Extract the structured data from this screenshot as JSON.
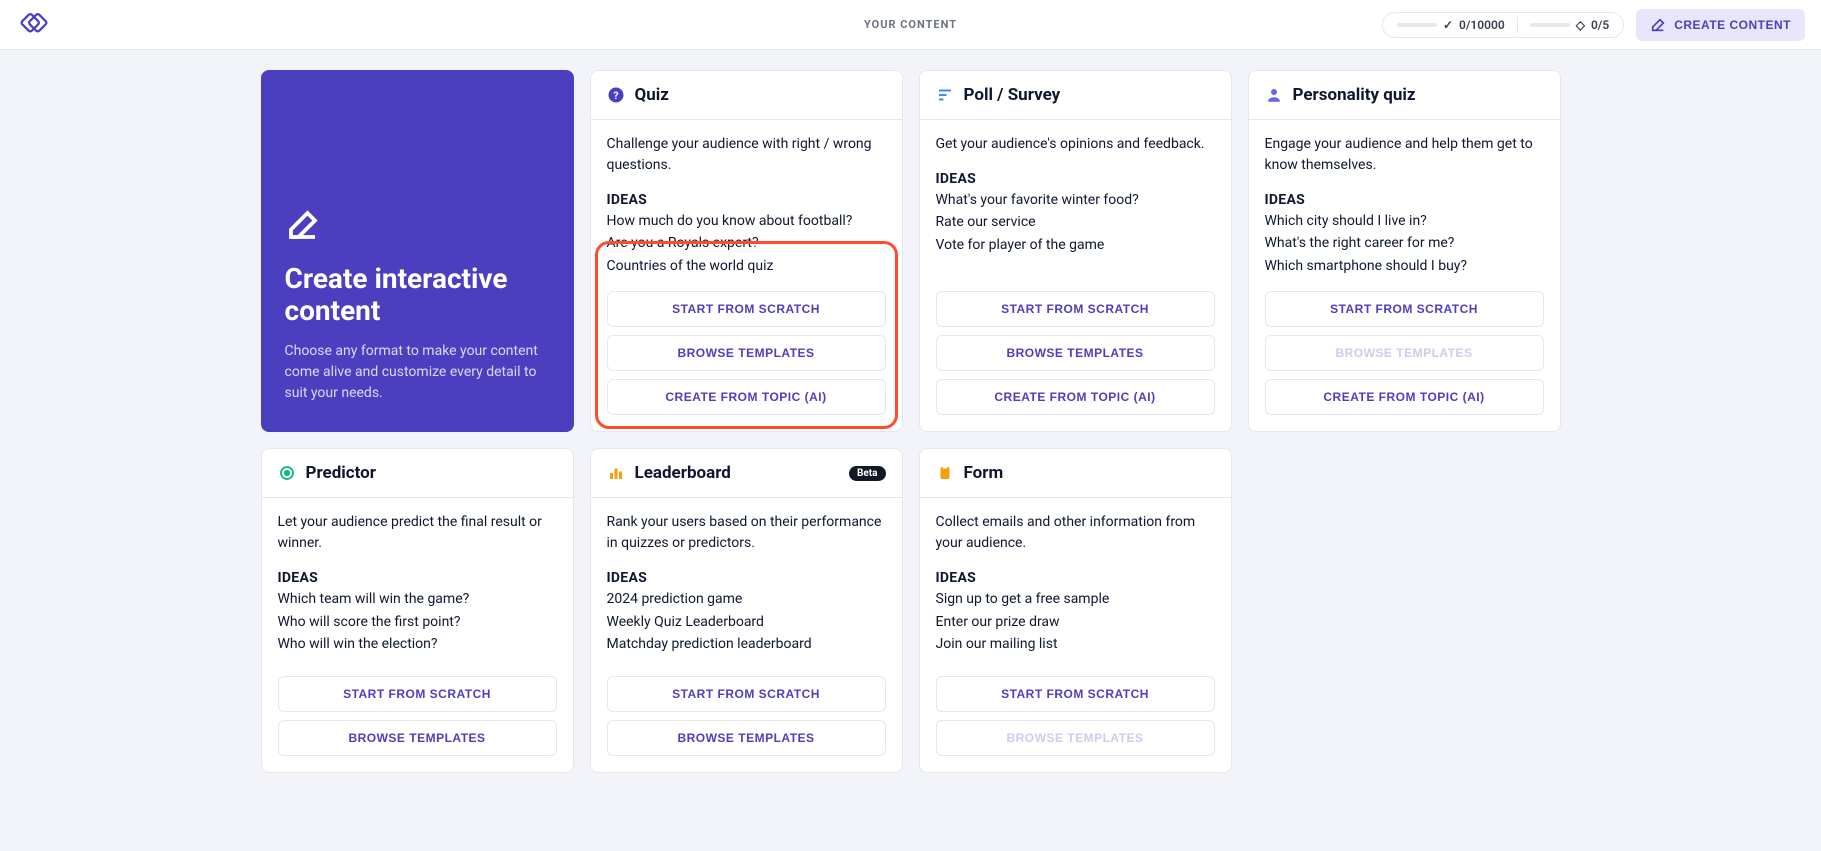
{
  "header": {
    "pageTitle": "YOUR CONTENT",
    "quota": {
      "credits": "0/10000",
      "slots": "0/5"
    },
    "createButton": "CREATE CONTENT"
  },
  "hero": {
    "title": "Create interactive content",
    "subtitle": "Choose any format to make your content come alive and customize every detail to suit your needs."
  },
  "ideasLabel": "IDEAS",
  "buttons": {
    "scratch": "START FROM SCRATCH",
    "templates": "BROWSE TEMPLATES",
    "ai": "CREATE FROM TOPIC (AI)"
  },
  "cards": {
    "quiz": {
      "title": "Quiz",
      "desc": "Challenge your audience with right / wrong questions.",
      "ideas": [
        "How much do you know about football?",
        "Are you a Royals expert?",
        "Countries of the world quiz"
      ]
    },
    "poll": {
      "title": "Poll / Survey",
      "desc": "Get your audience's opinions and feedback.",
      "ideas": [
        "What's your favorite winter food?",
        "Rate our service",
        "Vote for player of the game"
      ]
    },
    "personality": {
      "title": "Personality quiz",
      "desc": "Engage your audience and help them get to know themselves.",
      "ideas": [
        "Which city should I live in?",
        "What's the right career for me?",
        "Which smartphone should I buy?"
      ]
    },
    "predictor": {
      "title": "Predictor",
      "desc": "Let your audience predict the final result or winner.",
      "ideas": [
        "Which team will win the game?",
        "Who will score the first point?",
        "Who will win the election?"
      ]
    },
    "leaderboard": {
      "title": "Leaderboard",
      "badge": "Beta",
      "desc": "Rank your users based on their performance in quizzes or predictors.",
      "ideas": [
        "2024 prediction game",
        "Weekly Quiz Leaderboard",
        "Matchday prediction leaderboard"
      ]
    },
    "form": {
      "title": "Form",
      "desc": "Collect emails and other information from your audience.",
      "ideas": [
        "Sign up to get a free sample",
        "Enter our prize draw",
        "Join our mailing list"
      ]
    }
  }
}
